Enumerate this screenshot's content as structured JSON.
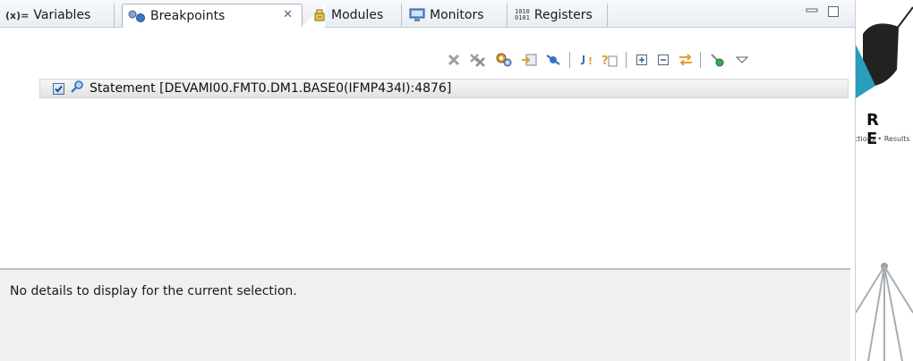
{
  "tabs": [
    {
      "id": "variables",
      "icon": "(x)=",
      "label": "Variables"
    },
    {
      "id": "breakpoints",
      "label": "Breakpoints",
      "close": "✕"
    },
    {
      "id": "modules",
      "label": "Modules"
    },
    {
      "id": "monitors",
      "label": "Monitors"
    },
    {
      "id": "registers",
      "icon": "1010\n0101",
      "label": "Registers"
    }
  ],
  "breakpoints": [
    {
      "checked": true,
      "label": "Statement [DEVAMI00.FMT0.DM1.BASE0(IFMP434I):4876]"
    }
  ],
  "details": {
    "text": "No details to display for the current selection."
  },
  "background": {
    "letters": "R E",
    "tagline": "ctions • Results"
  },
  "colors": {
    "accent": "#2f6fbf",
    "tab_active_bg": "#ffffff",
    "details_bg": "#f0f0f0"
  }
}
